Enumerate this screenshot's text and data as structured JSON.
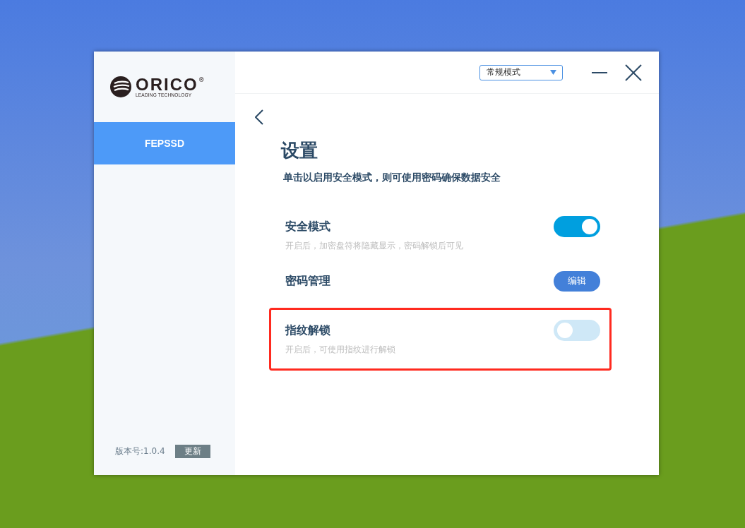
{
  "logo": {
    "brand": "ORICO",
    "registered": "®",
    "tagline": "LEADING TECHNOLOGY"
  },
  "sidebar": {
    "items": [
      {
        "label": "FEPSSD",
        "selected": true
      }
    ],
    "version": "版本号:1.0.4",
    "update_button": "更新"
  },
  "header": {
    "mode_select": {
      "value": "常规模式"
    }
  },
  "page": {
    "title": "设置",
    "subtitle": "单击以启用安全模式，则可使用密码确保数据安全",
    "settings": [
      {
        "kind": "toggle",
        "label": "安全模式",
        "description": "开启后，加密盘符将隐藏显示，密码解锁后可见",
        "on": true,
        "highlighted": false
      },
      {
        "kind": "button",
        "label": "密码管理",
        "button": "编辑",
        "highlighted": false
      },
      {
        "kind": "toggle",
        "label": "指纹解锁",
        "description": "开启后，可使用指纹进行解锁",
        "on": false,
        "highlighted": true
      }
    ]
  }
}
